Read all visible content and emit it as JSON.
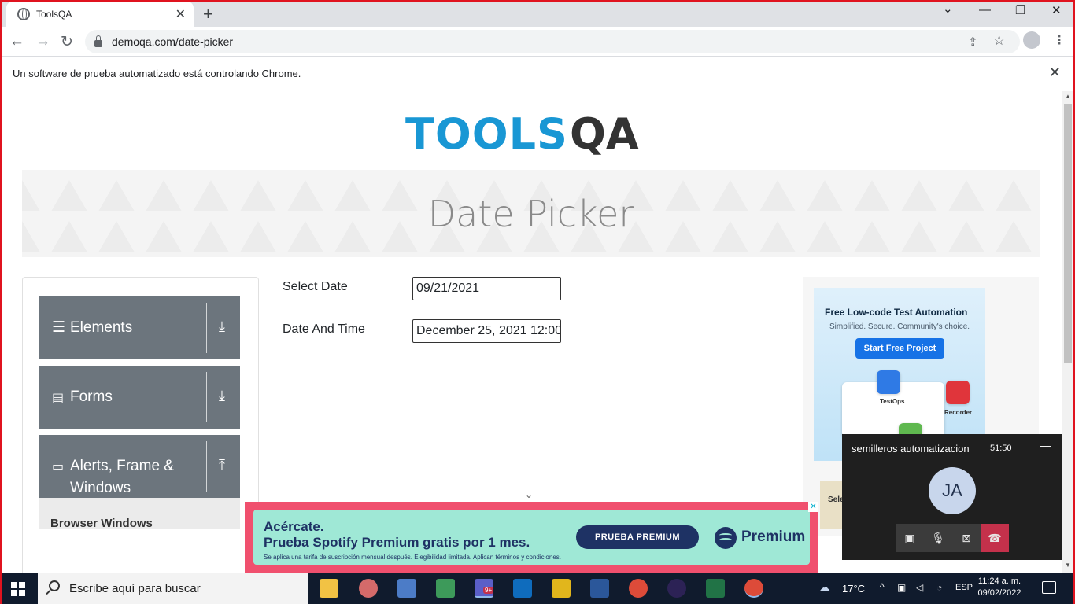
{
  "browser": {
    "tab_title": "ToolsQA",
    "tab_close": "✕",
    "new_tab": "+",
    "window_controls": {
      "minimize": "—",
      "restore": "❐",
      "close": "✕",
      "tab_search": "⌄"
    },
    "nav": {
      "back": "←",
      "forward": "→",
      "reload": "↻"
    },
    "url": "demoqa.com/date-picker",
    "share_icon": "⇪",
    "bookmark_icon": "☆",
    "menu_icon": "⋮",
    "infobar_text": "Un software de prueba automatizado está controlando Chrome.",
    "infobar_close": "✕"
  },
  "page": {
    "logo_tools": "TOOLS",
    "logo_qa": "QA",
    "title": "Date Picker",
    "sidebar": {
      "groups": [
        {
          "label": "Elements",
          "icon": "☰",
          "toggle": "⤓"
        },
        {
          "label": "Forms",
          "icon": "▤",
          "toggle": "⤓"
        },
        {
          "label": "Alerts, Frame & Windows",
          "icon": "▭",
          "toggle": "⤒"
        }
      ],
      "subitem": "Browser Windows"
    },
    "form": {
      "select_date_label": "Select Date",
      "select_date_value": "09/21/2021",
      "date_time_label": "Date And Time",
      "date_time_value": "December 25, 2021 12:00"
    },
    "scroll_chevron": "⌄",
    "ad_right": {
      "title": "Free Low-code Test Automation",
      "subtitle": "Simplified. Secure. Community's choice.",
      "button": "Start Free Project",
      "card_testops": "TestOps",
      "card_recorder": "Recorder",
      "peek_label": "Sele"
    },
    "ad_bottom": {
      "headline1": "Acércate.",
      "headline2": "Prueba Spotify Premium gratis por 1 mes.",
      "fineprint": "Se aplica una tarifa de suscripción mensual después. Elegibilidad limitada. Aplican términos y condiciones.",
      "button": "PRUEBA PREMIUM",
      "brand": "Premium",
      "close": "✕",
      "colors": {
        "outer": "#f0506e",
        "inner": "#9fe8d6",
        "navy": "#1e3264"
      }
    }
  },
  "teams_call": {
    "name": "semilleros automatizacion",
    "timer": "51:50",
    "minimize": "—",
    "initials": "JA",
    "controls": [
      "camera-off-icon",
      "mic-icon",
      "share-screen-icon",
      "hang-up-icon"
    ],
    "control_glyphs": {
      "camera": "▣",
      "mic": "🎙",
      "share": "⊠",
      "hangup": "☎"
    }
  },
  "taskbar": {
    "search_placeholder": "Escribe aquí para buscar",
    "teams_badge": "9+",
    "weather": "17°C",
    "up_arrow": "^",
    "language": "ESP",
    "time": "11:24 a. m.",
    "date": "09/02/2022"
  }
}
